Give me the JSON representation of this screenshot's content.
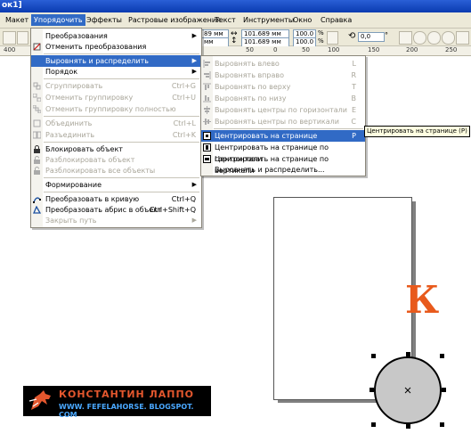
{
  "window": {
    "title": "ок1]"
  },
  "menubar": {
    "items": [
      "Макет",
      "Упорядочить",
      "Эффекты",
      "Растровые изображения",
      "Текст",
      "Инструменты",
      "Окно",
      "Справка"
    ],
    "active_index": 1
  },
  "toolbar": {
    "width_value": "101.689 мм",
    "height_value": "101.689 мм",
    "x_value": "89 мм",
    "y_value": "мм",
    "scale_x": "100.0",
    "scale_y": "100.0",
    "percent": "%",
    "rotation_value": "0,0",
    "rotation_unit": "°"
  },
  "ruler": {
    "labels": [
      "400",
      "50",
      "0",
      "50",
      "100",
      "150",
      "200",
      "250"
    ]
  },
  "main_menu": {
    "items": [
      {
        "label": "Преобразования",
        "shortcut": "",
        "submenu": true,
        "disabled": false,
        "icon": ""
      },
      {
        "label": "Отменить преобразования",
        "shortcut": "",
        "submenu": false,
        "disabled": false,
        "icon": "clear-transform-icon"
      },
      {
        "label": "Выровнять и распределить",
        "shortcut": "",
        "submenu": true,
        "disabled": false,
        "icon": "",
        "highlighted": true
      },
      {
        "label": "Порядок",
        "shortcut": "",
        "submenu": true,
        "disabled": false,
        "icon": ""
      },
      {
        "label": "Сгруппировать",
        "shortcut": "Ctrl+G",
        "submenu": false,
        "disabled": true,
        "icon": "group-icon"
      },
      {
        "label": "Отменить группировку",
        "shortcut": "Ctrl+U",
        "submenu": false,
        "disabled": true,
        "icon": "ungroup-icon"
      },
      {
        "label": "Отменить группировку полностью",
        "shortcut": "",
        "submenu": false,
        "disabled": true,
        "icon": "ungroup-all-icon"
      },
      {
        "label": "Объединить",
        "shortcut": "Ctrl+L",
        "submenu": false,
        "disabled": true,
        "icon": "combine-icon"
      },
      {
        "label": "Разъединить",
        "shortcut": "Ctrl+K",
        "submenu": false,
        "disabled": true,
        "icon": "break-apart-icon"
      },
      {
        "label": "Блокировать объект",
        "shortcut": "",
        "submenu": false,
        "disabled": false,
        "icon": "lock-icon"
      },
      {
        "label": "Разблокировать объект",
        "shortcut": "",
        "submenu": false,
        "disabled": true,
        "icon": "unlock-icon"
      },
      {
        "label": "Разблокировать все объекты",
        "shortcut": "",
        "submenu": false,
        "disabled": true,
        "icon": "unlock-all-icon"
      },
      {
        "label": "Формирование",
        "shortcut": "",
        "submenu": true,
        "disabled": false,
        "icon": ""
      },
      {
        "label": "Преобразовать в кривую",
        "shortcut": "Ctrl+Q",
        "submenu": false,
        "disabled": false,
        "icon": "convert-curve-icon"
      },
      {
        "label": "Преобразовать абрис в объект",
        "shortcut": "Ctrl+Shift+Q",
        "submenu": false,
        "disabled": false,
        "icon": "outline-object-icon"
      },
      {
        "label": "Закрыть путь",
        "shortcut": "",
        "submenu": true,
        "disabled": true,
        "icon": ""
      }
    ]
  },
  "sub_menu": {
    "items": [
      {
        "label": "Выровнять влево",
        "shortcut": "L",
        "disabled": true,
        "icon": "align-left-icon"
      },
      {
        "label": "Выровнять вправо",
        "shortcut": "R",
        "disabled": true,
        "icon": "align-right-icon"
      },
      {
        "label": "Выровнять по верху",
        "shortcut": "T",
        "disabled": true,
        "icon": "align-top-icon"
      },
      {
        "label": "Выровнять по низу",
        "shortcut": "B",
        "disabled": true,
        "icon": "align-bottom-icon"
      },
      {
        "label": "Выровнять центры по горизонтали",
        "shortcut": "E",
        "disabled": true,
        "icon": "align-center-h-icon"
      },
      {
        "label": "Выровнять центры по вертикали",
        "shortcut": "C",
        "disabled": true,
        "icon": "align-center-v-icon"
      },
      {
        "label": "Центрировать на странице",
        "shortcut": "P",
        "disabled": false,
        "icon": "center-page-icon",
        "highlighted": true
      },
      {
        "label": "Центрировать на странице по горизонтали",
        "shortcut": "",
        "disabled": false,
        "icon": "center-page-h-icon"
      },
      {
        "label": "Центрировать на странице по вертикали",
        "shortcut": "",
        "disabled": false,
        "icon": "center-page-v-icon"
      },
      {
        "label": "Выровнять и распределить...",
        "shortcut": "",
        "disabled": false,
        "icon": ""
      }
    ]
  },
  "tooltip": {
    "text": "Центрировать на странице (P)"
  },
  "canvas": {
    "letter": "К",
    "letter_color": "#e85a1c",
    "circle_fill": "#c8c8c8"
  },
  "logo": {
    "name": "КОНСТАНТИН ЛАППО",
    "url": "WWW. FEFELAHORSE. BLOGSPOT. COM"
  },
  "colors": {
    "accent": "#316ac5",
    "menu_bg": "#ece9d8"
  }
}
